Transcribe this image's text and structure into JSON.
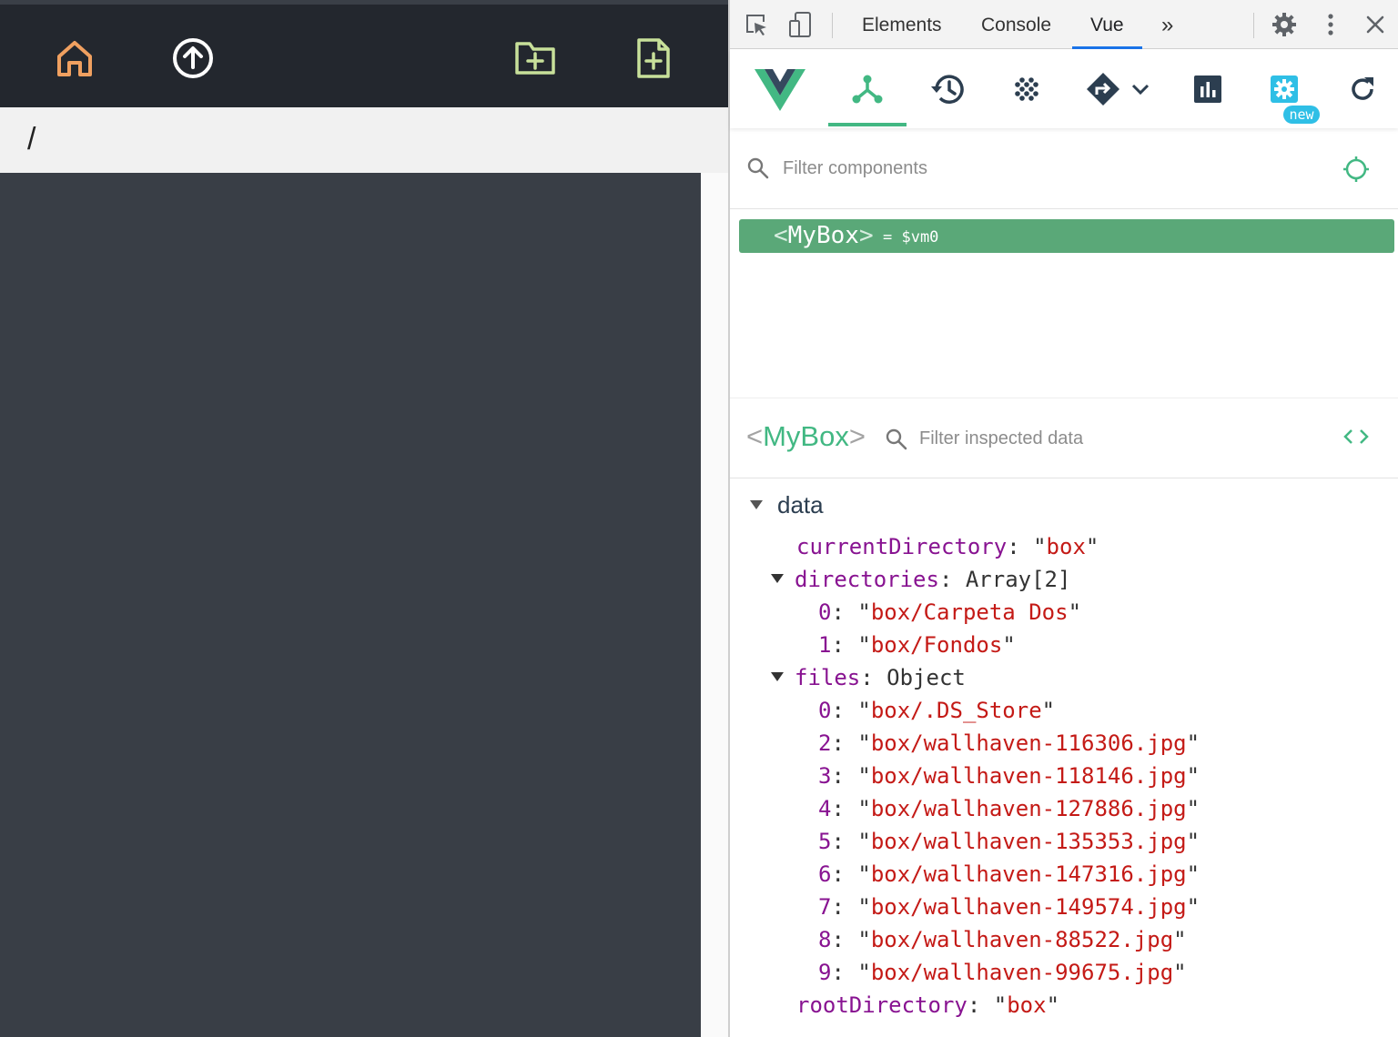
{
  "app": {
    "path": "/",
    "colors": {
      "toolbar_bg": "#23272e",
      "home_icon": "#f0a060",
      "upload_icon": "#ffffff",
      "new_folder_icon": "#c8e09a",
      "new_file_icon": "#c8e09a",
      "content_bg": "#393e46"
    },
    "toolbar_icons": [
      "home-icon",
      "upload-icon",
      "new-folder-icon",
      "new-file-icon"
    ]
  },
  "devtools": {
    "tabs": [
      {
        "label": "Elements",
        "active": false
      },
      {
        "label": "Console",
        "active": false
      },
      {
        "label": "Vue",
        "active": true
      }
    ],
    "more_tabs_glyph": "»",
    "close_glyph": "✕",
    "vue_toolbar": {
      "icons": [
        "vue-logo-icon",
        "components-icon",
        "timeline-icon",
        "vuex-icon",
        "routing-icon",
        "performance-icon",
        "settings-icon",
        "refresh-icon"
      ],
      "badge": "new",
      "accent": "#42b883"
    },
    "filter_components": {
      "placeholder": "Filter components"
    },
    "component_tree": {
      "selected": {
        "open": "<",
        "name": "MyBox",
        "close": ">",
        "vm": "= $vm0"
      }
    },
    "inspector": {
      "name_open": "<",
      "name": "MyBox",
      "name_close": ">",
      "filter_placeholder": "Filter inspected data",
      "section": "data",
      "fields": {
        "currentDirectory": {
          "key": "currentDirectory",
          "value": "box"
        },
        "directories": {
          "key": "directories",
          "type": "Array[2]",
          "items": [
            {
              "index": "0",
              "value": "box/Carpeta Dos"
            },
            {
              "index": "1",
              "value": "box/Fondos"
            }
          ]
        },
        "files": {
          "key": "files",
          "type": "Object",
          "items": [
            {
              "index": "0",
              "value": "box/.DS_Store"
            },
            {
              "index": "2",
              "value": "box/wallhaven-116306.jpg"
            },
            {
              "index": "3",
              "value": "box/wallhaven-118146.jpg"
            },
            {
              "index": "4",
              "value": "box/wallhaven-127886.jpg"
            },
            {
              "index": "5",
              "value": "box/wallhaven-135353.jpg"
            },
            {
              "index": "6",
              "value": "box/wallhaven-147316.jpg"
            },
            {
              "index": "7",
              "value": "box/wallhaven-149574.jpg"
            },
            {
              "index": "8",
              "value": "box/wallhaven-88522.jpg"
            },
            {
              "index": "9",
              "value": "box/wallhaven-99675.jpg"
            }
          ]
        },
        "rootDirectory": {
          "key": "rootDirectory",
          "value": "box"
        }
      }
    }
  }
}
